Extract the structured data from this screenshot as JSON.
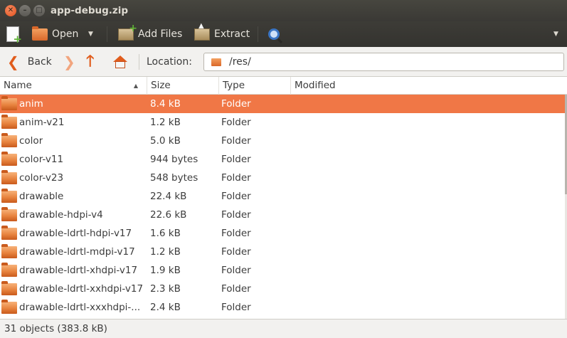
{
  "window": {
    "title": "app-debug.zip"
  },
  "toolbar": {
    "open_label": "Open",
    "add_files_label": "Add Files",
    "extract_label": "Extract"
  },
  "locationbar": {
    "back_label": "Back",
    "location_label": "Location:",
    "path": "/res/"
  },
  "table": {
    "columns": [
      "Name",
      "Size",
      "Type",
      "Modified"
    ],
    "sorted_by": "Name",
    "rows": [
      {
        "name": "anim",
        "size": "8.4 kB",
        "type": "Folder",
        "modified": "",
        "selected": true
      },
      {
        "name": "anim-v21",
        "size": "1.2 kB",
        "type": "Folder",
        "modified": ""
      },
      {
        "name": "color",
        "size": "5.0 kB",
        "type": "Folder",
        "modified": ""
      },
      {
        "name": "color-v11",
        "size": "944 bytes",
        "type": "Folder",
        "modified": ""
      },
      {
        "name": "color-v23",
        "size": "548 bytes",
        "type": "Folder",
        "modified": ""
      },
      {
        "name": "drawable",
        "size": "22.4 kB",
        "type": "Folder",
        "modified": ""
      },
      {
        "name": "drawable-hdpi-v4",
        "size": "22.6 kB",
        "type": "Folder",
        "modified": ""
      },
      {
        "name": "drawable-ldrtl-hdpi-v17",
        "size": "1.6 kB",
        "type": "Folder",
        "modified": ""
      },
      {
        "name": "drawable-ldrtl-mdpi-v17",
        "size": "1.2 kB",
        "type": "Folder",
        "modified": ""
      },
      {
        "name": "drawable-ldrtl-xhdpi-v17",
        "size": "1.9 kB",
        "type": "Folder",
        "modified": ""
      },
      {
        "name": "drawable-ldrtl-xxhdpi-v17",
        "size": "2.3 kB",
        "type": "Folder",
        "modified": ""
      },
      {
        "name": "drawable-ldrtl-xxxhdpi-...",
        "size": "2.4 kB",
        "type": "Folder",
        "modified": ""
      }
    ]
  },
  "status": {
    "text": "31 objects (383.8 kB)"
  },
  "colors": {
    "selection": "#f07746",
    "accent": "#e05c1c",
    "titlebar": "#3c3b37"
  },
  "icons": [
    "close-icon",
    "minimize-icon",
    "maximize-icon",
    "new-archive-icon",
    "open-folder-icon",
    "add-files-icon",
    "extract-icon",
    "find-icon",
    "back-arrow-icon",
    "forward-arrow-icon",
    "up-arrow-icon",
    "home-icon",
    "folder-icon"
  ]
}
